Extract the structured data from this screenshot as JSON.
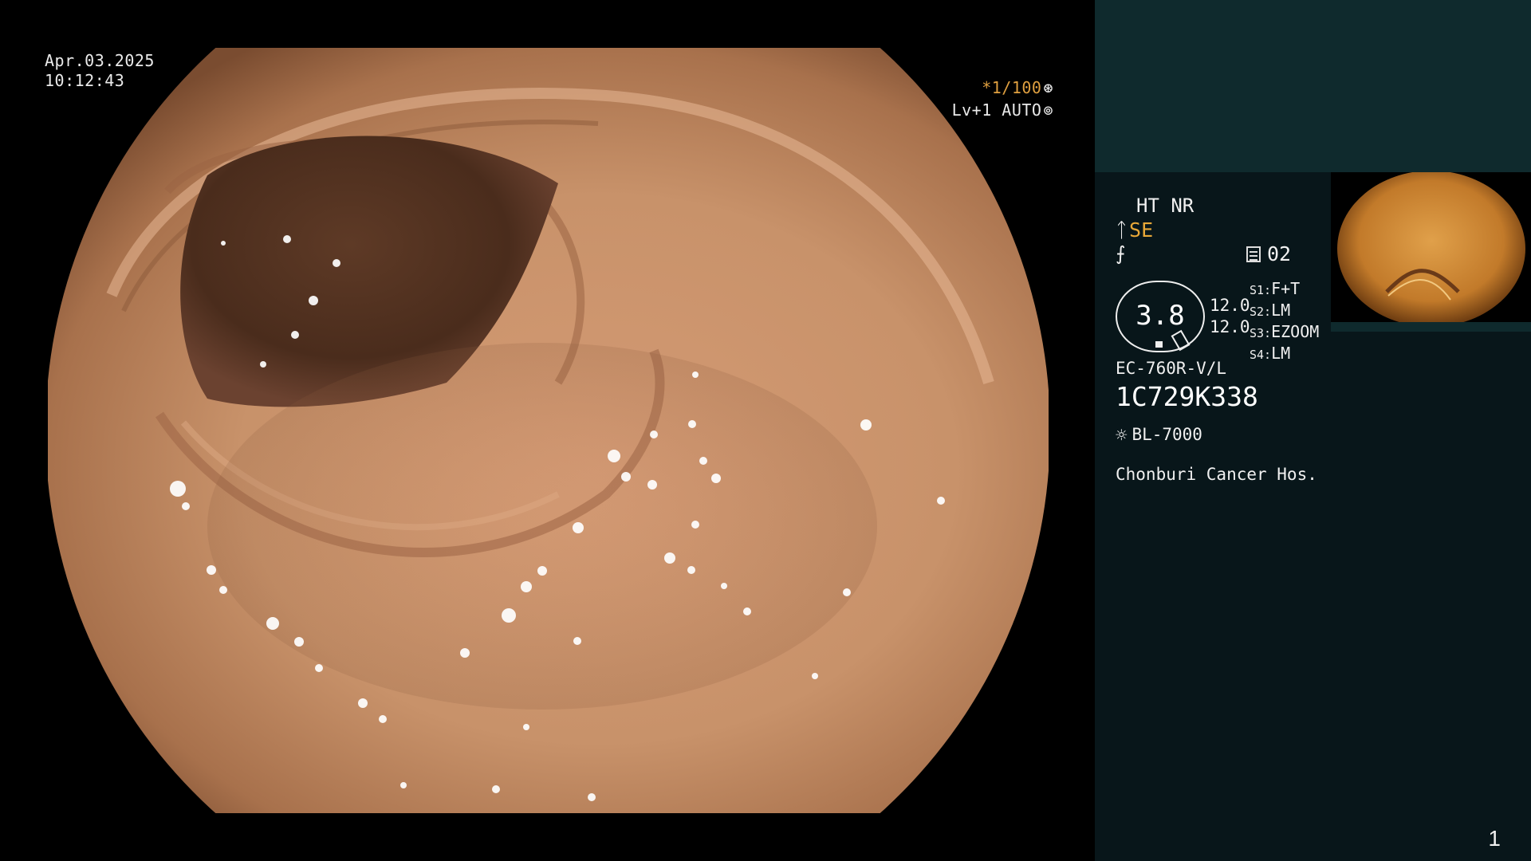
{
  "overlay": {
    "date": "Apr.03.2025",
    "time": "10:12:43",
    "shutter": "*1/100",
    "shutter_icon": "iris-icon",
    "level": "Lv+1 AUTO",
    "level_icon": "auto-iris-icon"
  },
  "panel": {
    "ht_nr": "HT NR",
    "se_prefix": "ᛏ",
    "se": "SE",
    "f_mark": "⨍",
    "memory_icon": "memory-card-icon",
    "memory": "02",
    "octagon_value": "3.8",
    "vals": [
      "12.0",
      "12.0"
    ],
    "slots": [
      {
        "label": "S1:",
        "value": "F+T"
      },
      {
        "label": "S2:",
        "value": "LM"
      },
      {
        "label": "S3:",
        "value": "EZOOM"
      },
      {
        "label": "S4:",
        "value": "LM"
      }
    ],
    "scope_model": "EC-760R-V/L",
    "serial": "1C729K338",
    "light_icon": "sun-icon",
    "light_source": "BL-7000",
    "hospital": "Chonburi Cancer Hos.",
    "page": "1"
  },
  "colors": {
    "panel_top": "#0f2a2d",
    "panel_bottom": "#08161a",
    "accent_orange": "#e8a838"
  }
}
